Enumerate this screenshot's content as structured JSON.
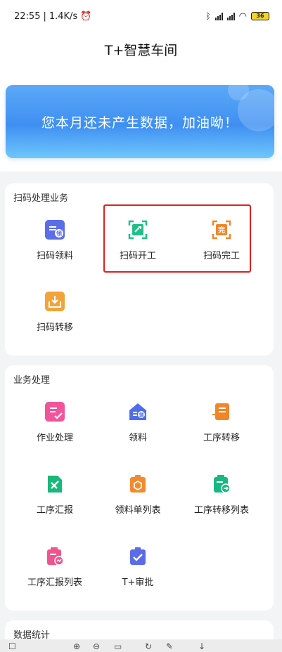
{
  "status": {
    "time": "22:55",
    "speed": "1.4K/s",
    "battery": "36"
  },
  "header": {
    "title": "T+智慧车间"
  },
  "banner": {
    "text": "您本月还未产生数据，加油呦！"
  },
  "scan_section": {
    "title": "扫码处理业务",
    "items": [
      {
        "label": "扫码领料",
        "icon": "scan-material-icon",
        "color": "#5b6ee8"
      },
      {
        "label": "扫码开工",
        "icon": "scan-start-work-icon",
        "color": "#1fbf8a"
      },
      {
        "label": "扫码完工",
        "icon": "scan-complete-icon",
        "color": "#f0862a"
      },
      {
        "label": "扫码转移",
        "icon": "scan-transfer-icon",
        "color": "#f2a43a"
      }
    ]
  },
  "business_section": {
    "title": "业务处理",
    "items": [
      {
        "label": "作业处理",
        "icon": "job-processing-icon",
        "color": "#f2549b"
      },
      {
        "label": "领料",
        "icon": "material-picking-icon",
        "color": "#4e6ee8"
      },
      {
        "label": "工序转移",
        "icon": "process-transfer-icon",
        "color": "#f0862a"
      },
      {
        "label": "工序汇报",
        "icon": "process-report-icon",
        "color": "#18b97a"
      },
      {
        "label": "领料单列表",
        "icon": "picking-list-icon",
        "color": "#f28a2e"
      },
      {
        "label": "工序转移列表",
        "icon": "transfer-list-icon",
        "color": "#19b880"
      },
      {
        "label": "工序汇报列表",
        "icon": "report-list-icon",
        "color": "#f0548f"
      },
      {
        "label": "T+审批",
        "icon": "approval-icon",
        "color": "#5a6ce8"
      }
    ]
  },
  "stats_section": {
    "title": "数据统计"
  }
}
